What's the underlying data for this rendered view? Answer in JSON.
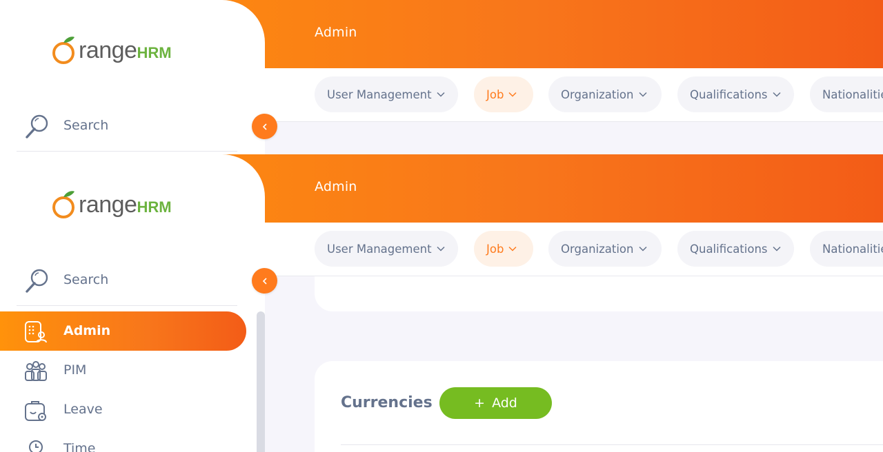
{
  "app": {
    "brand_prefix": "range",
    "brand_suffix": "HRM"
  },
  "header": {
    "title": "Admin"
  },
  "sidebar": {
    "search_label": "Search",
    "items": [
      {
        "label": "Admin",
        "icon": "admin-icon",
        "active": true
      },
      {
        "label": "PIM",
        "icon": "pim-icon",
        "active": false
      },
      {
        "label": "Leave",
        "icon": "leave-icon",
        "active": false
      },
      {
        "label": "Time",
        "icon": "time-icon",
        "active": false
      }
    ]
  },
  "topnav": {
    "tabs": [
      {
        "label": "User Management",
        "active": false
      },
      {
        "label": "Job",
        "active": true
      },
      {
        "label": "Organization",
        "active": false
      },
      {
        "label": "Qualifications",
        "active": false
      },
      {
        "label": "Nationalities",
        "active": false
      }
    ]
  },
  "main": {
    "section_title": "Currencies",
    "add_label": "Add",
    "add_symbol": "+"
  },
  "colors": {
    "accent": "#ff7b1d",
    "add_button": "#76bc21",
    "text_muted": "#64728c"
  }
}
